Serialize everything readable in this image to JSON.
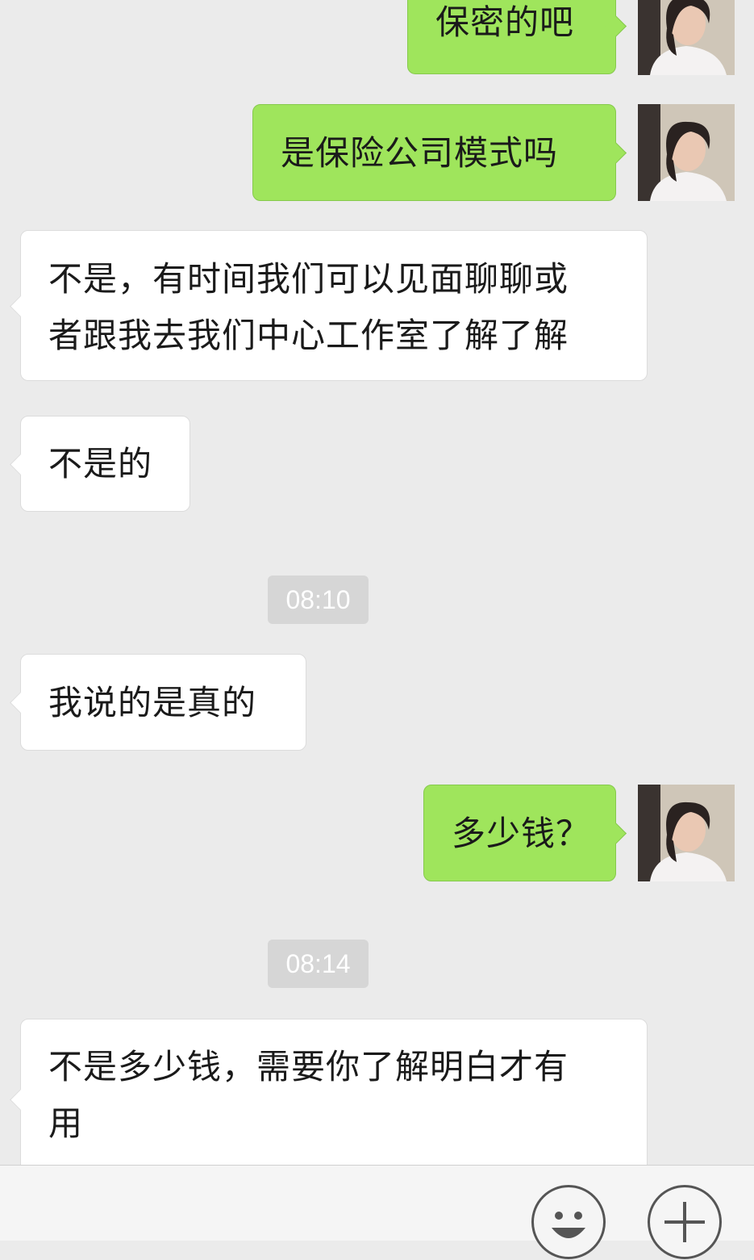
{
  "messages": [
    {
      "dir": "out",
      "text": "保密的吧"
    },
    {
      "dir": "out",
      "text": "是保险公司模式吗"
    },
    {
      "dir": "in",
      "lines": [
        "不是，有时间我们可以见面聊聊或",
        "者跟我去我们中心工作室了解了解"
      ]
    },
    {
      "dir": "in",
      "text": "不是的"
    },
    {
      "time": "08:10"
    },
    {
      "dir": "in",
      "text": "我说的是真的"
    },
    {
      "dir": "out",
      "text": "多少钱？"
    },
    {
      "time": "08:14"
    },
    {
      "dir": "in",
      "lines": [
        "不是多少钱，需要你了解明白才有",
        "用"
      ]
    }
  ],
  "input_bar": {
    "emoji_icon": "emoji-icon",
    "more_icon": "plus-icon"
  },
  "colors": {
    "background": "#ebebeb",
    "outgoing_bubble": "#9fe55c",
    "incoming_bubble": "#ffffff",
    "timestamp_bg": "#d6d6d6"
  }
}
